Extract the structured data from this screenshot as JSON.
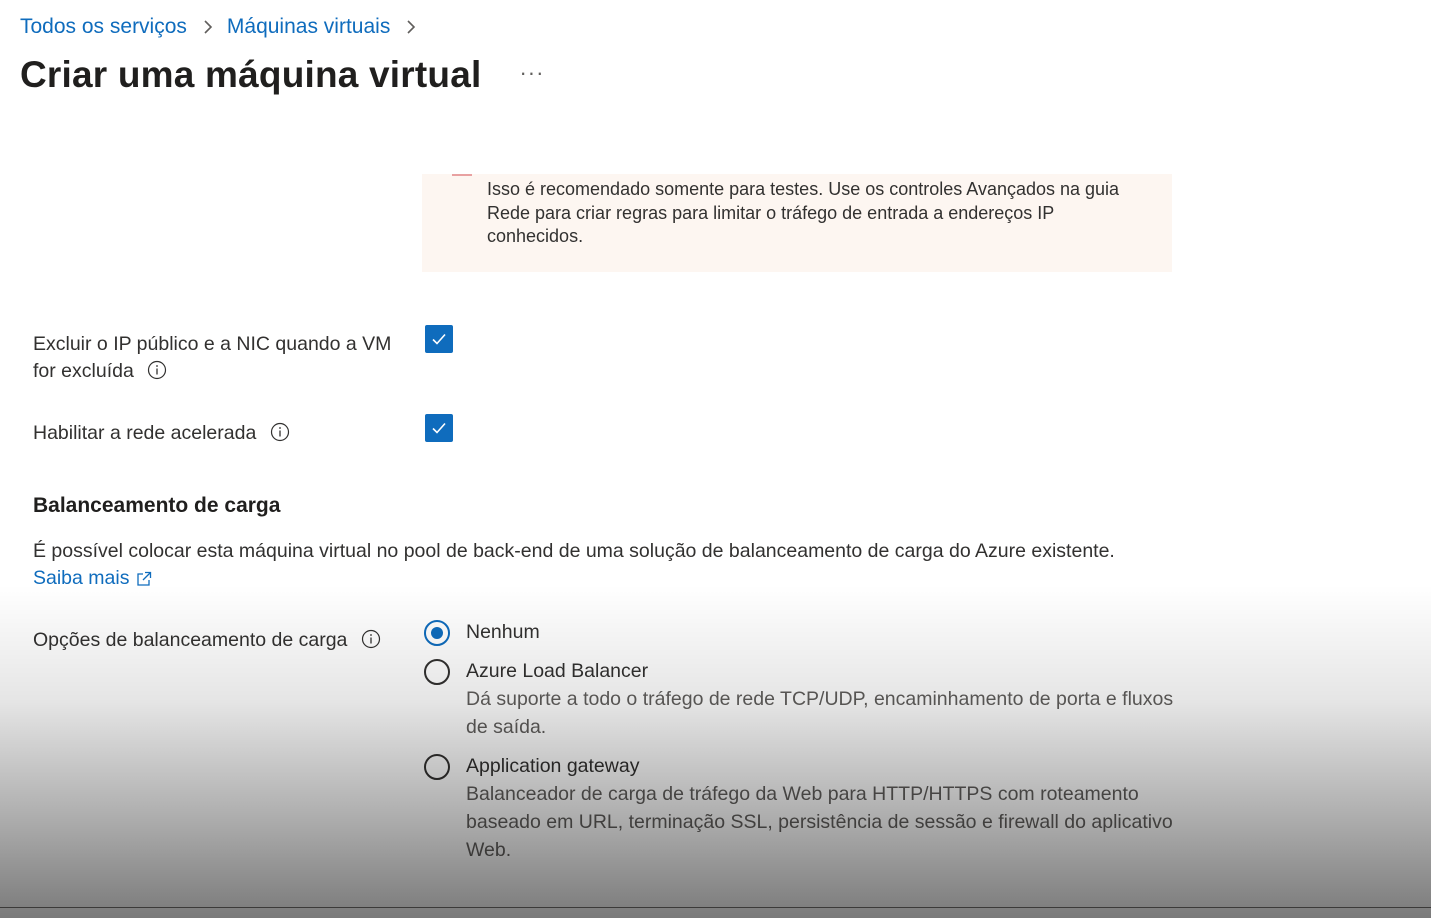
{
  "breadcrumb": {
    "items": [
      "Todos os serviços",
      "Máquinas virtuais"
    ]
  },
  "header": {
    "title": "Criar uma máquina virtual",
    "more_label": "···"
  },
  "warning": {
    "text": " Isso é recomendado somente para testes.  Use os controles Avançados na guia Rede para criar regras para limitar o tráfego de entrada a endereços IP conhecidos."
  },
  "fields": {
    "delete_ip_nic": {
      "label_line1": "Excluir o IP público e a NIC quando a VM",
      "label_line2": "for excluída",
      "checked": true
    },
    "accelerated_networking": {
      "label": "Habilitar a rede acelerada",
      "checked": true
    }
  },
  "load_balancing": {
    "heading": "Balanceamento de carga",
    "description": "É possível colocar esta máquina virtual no pool de back-end de uma solução de balanceamento de carga do Azure existente.",
    "learn_more": "Saiba mais",
    "options_label": "Opções de balanceamento de carga",
    "selected": "Nenhum",
    "options": [
      {
        "label": "Nenhum",
        "description": ""
      },
      {
        "label": "Azure Load Balancer",
        "description": "Dá suporte a todo o tráfego de rede TCP/UDP, encaminhamento de porta e fluxos de saída."
      },
      {
        "label": "Application gateway",
        "description": "Balanceador de carga de tráfego da Web para HTTP/HTTPS com roteamento baseado em URL, terminação SSL, persistência de sessão e firewall do aplicativo Web."
      }
    ]
  },
  "colors": {
    "accent": "#0f6cbd",
    "warning_bg": "#fdf6f1",
    "text": "#323130",
    "secondary_text": "#605e5c"
  },
  "icons": {
    "breadcrumb_separator": "chevron-right-icon",
    "info": "info-icon",
    "external_link": "external-link-icon",
    "checkmark": "checkmark-icon"
  }
}
